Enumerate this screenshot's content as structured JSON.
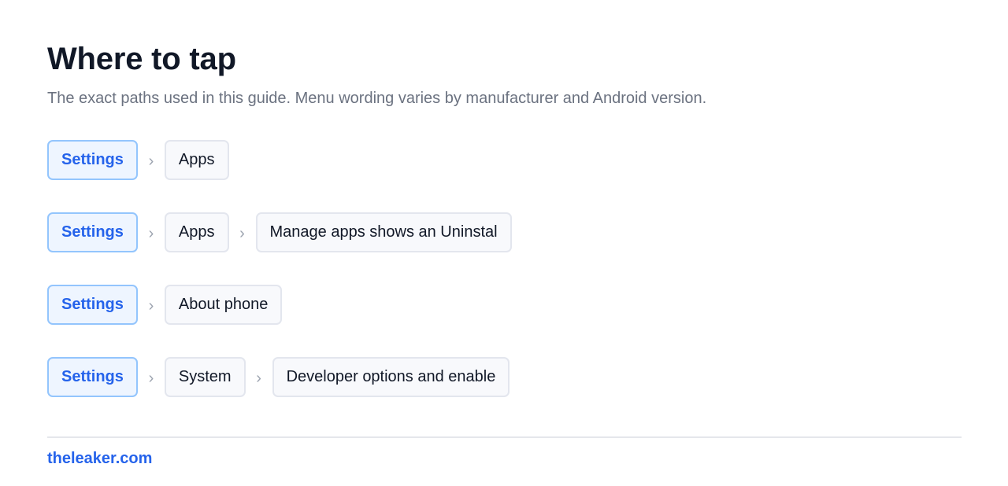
{
  "header": {
    "title": "Where to tap",
    "subtitle": "The exact paths used in this guide. Menu wording varies by manufacturer and Android version."
  },
  "paths": [
    {
      "steps": [
        "Settings",
        "Apps"
      ]
    },
    {
      "steps": [
        "Settings",
        "Apps",
        "Manage apps shows an Uninstal"
      ]
    },
    {
      "steps": [
        "Settings",
        "About phone"
      ]
    },
    {
      "steps": [
        "Settings",
        "System",
        "Developer options and enable"
      ]
    }
  ],
  "separator_glyph": "›",
  "footer": {
    "link": "theleaker.com"
  },
  "colors": {
    "accent": "#2563eb",
    "accent_border": "#93c5fd",
    "accent_bg": "#eef5ff",
    "chip_border": "#e3e6ee",
    "chip_bg": "#f8f9fc",
    "muted_text": "#6b7280"
  }
}
